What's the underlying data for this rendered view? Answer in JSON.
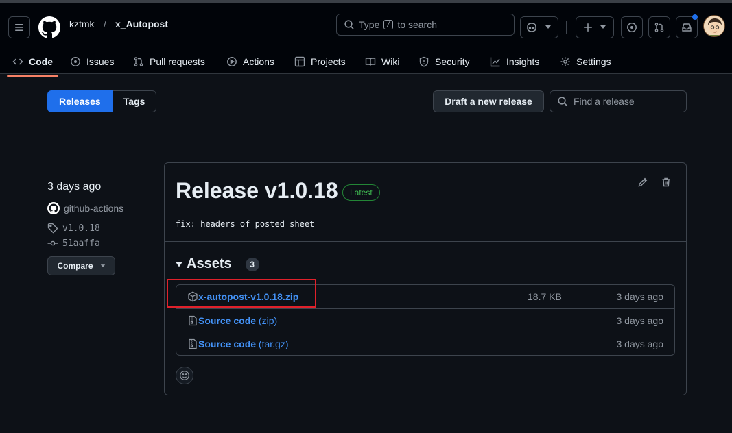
{
  "header": {
    "owner": "kztmk",
    "separator": "/",
    "repo": "x_Autopost",
    "search": {
      "prefix": "Type",
      "key": "/",
      "suffix": "to search"
    }
  },
  "nav": {
    "tabs": [
      {
        "label": "Code",
        "icon": "code-icon",
        "active": true
      },
      {
        "label": "Issues",
        "icon": "issue-icon"
      },
      {
        "label": "Pull requests",
        "icon": "pull-request-icon"
      },
      {
        "label": "Actions",
        "icon": "play-icon"
      },
      {
        "label": "Projects",
        "icon": "table-icon"
      },
      {
        "label": "Wiki",
        "icon": "book-icon"
      },
      {
        "label": "Security",
        "icon": "shield-icon"
      },
      {
        "label": "Insights",
        "icon": "graph-icon"
      },
      {
        "label": "Settings",
        "icon": "gear-icon"
      }
    ]
  },
  "toolbar": {
    "releases_label": "Releases",
    "tags_label": "Tags",
    "draft_label": "Draft a new release",
    "find_placeholder": "Find a release"
  },
  "sidebar": {
    "time": "3 days ago",
    "author": "github-actions",
    "tag": "v1.0.18",
    "commit": "51aaffa",
    "compare_label": "Compare"
  },
  "release": {
    "title": "Release v1.0.18",
    "badge": "Latest",
    "description": "fix: headers of posted sheet",
    "assets_label": "Assets",
    "assets_count": "3",
    "assets": [
      {
        "name": "x-autopost-v1.0.18.zip",
        "suffix": "",
        "size": "18.7 KB",
        "date": "3 days ago",
        "icon": "package-icon"
      },
      {
        "name": "Source code",
        "suffix": "(zip)",
        "size": "",
        "date": "3 days ago",
        "icon": "file-zip-icon"
      },
      {
        "name": "Source code",
        "suffix": "(tar.gz)",
        "size": "",
        "date": "3 days ago",
        "icon": "file-zip-icon"
      }
    ]
  },
  "colors": {
    "accent": "#1f6feb",
    "link": "#4493f8",
    "latest": "#3fb950",
    "highlight": "#e0212b",
    "active_tab": "#f78166"
  }
}
